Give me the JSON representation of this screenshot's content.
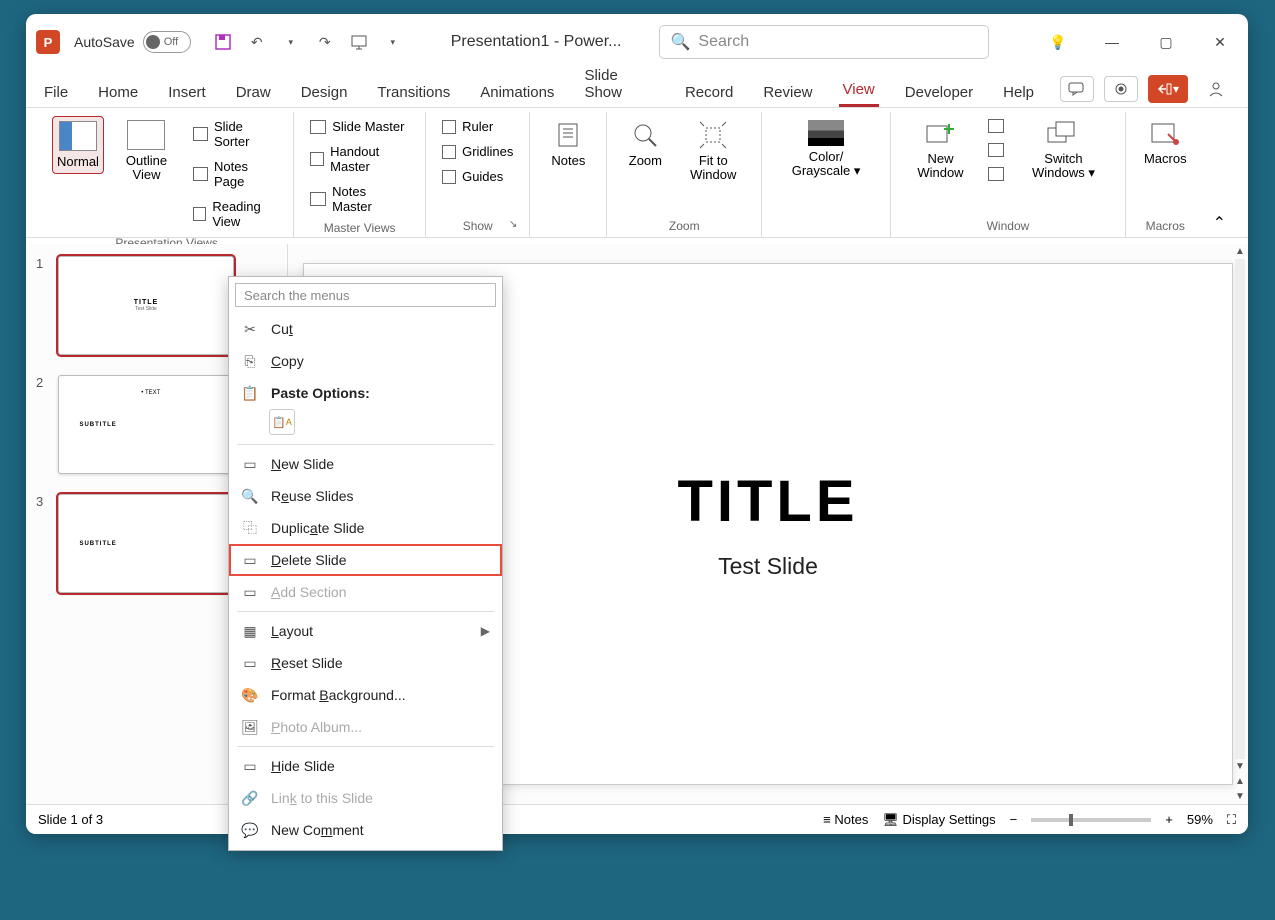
{
  "titlebar": {
    "autosave_label": "AutoSave",
    "autosave_state": "Off",
    "doc_title": "Presentation1  -  Power...",
    "search_placeholder": "Search"
  },
  "tabs": {
    "file": "File",
    "home": "Home",
    "insert": "Insert",
    "draw": "Draw",
    "design": "Design",
    "transitions": "Transitions",
    "animations": "Animations",
    "slideshow": "Slide Show",
    "record": "Record",
    "review": "Review",
    "view": "View",
    "developer": "Developer",
    "help": "Help"
  },
  "ribbon": {
    "normal": "Normal",
    "outline": "Outline View",
    "slide_sorter": "Slide Sorter",
    "notes_page": "Notes Page",
    "reading_view": "Reading View",
    "group_presentation": "Presentation Views",
    "slide_master": "Slide Master",
    "handout_master": "Handout Master",
    "notes_master": "Notes Master",
    "group_master": "Master Views",
    "ruler": "Ruler",
    "gridlines": "Gridlines",
    "guides": "Guides",
    "group_show": "Show",
    "notes": "Notes",
    "zoom": "Zoom",
    "fit": "Fit to Window",
    "group_zoom": "Zoom",
    "color": "Color/ Grayscale",
    "new_window": "New Window",
    "switch": "Switch Windows",
    "group_window": "Window",
    "macros": "Macros",
    "group_macros": "Macros"
  },
  "thumbs": {
    "n1": "1",
    "n2": "2",
    "n3": "3",
    "t1_title": "TITLE",
    "t1_sub": "Test Slide",
    "t2_left": "SUBTITLE",
    "t2_right": "• TEXT",
    "t3_left": "SUBTITLE"
  },
  "slide": {
    "title": "TITLE",
    "subtitle": "Test Slide"
  },
  "status": {
    "left": "Slide 1 of 3",
    "notes": "Notes",
    "display": "Display Settings",
    "zoom": "59%"
  },
  "ctx": {
    "search_placeholder": "Search the menus",
    "cut": "Cut",
    "copy": "Copy",
    "paste_options": "Paste Options:",
    "new_slide": "New Slide",
    "reuse": "Reuse Slides",
    "duplicate": "Duplicate Slide",
    "delete": "Delete Slide",
    "add_section": "Add Section",
    "layout": "Layout",
    "reset": "Reset Slide",
    "format_bg": "Format Background...",
    "photo": "Photo Album...",
    "hide": "Hide Slide",
    "link": "Link to this Slide",
    "new_comment": "New Comment"
  }
}
